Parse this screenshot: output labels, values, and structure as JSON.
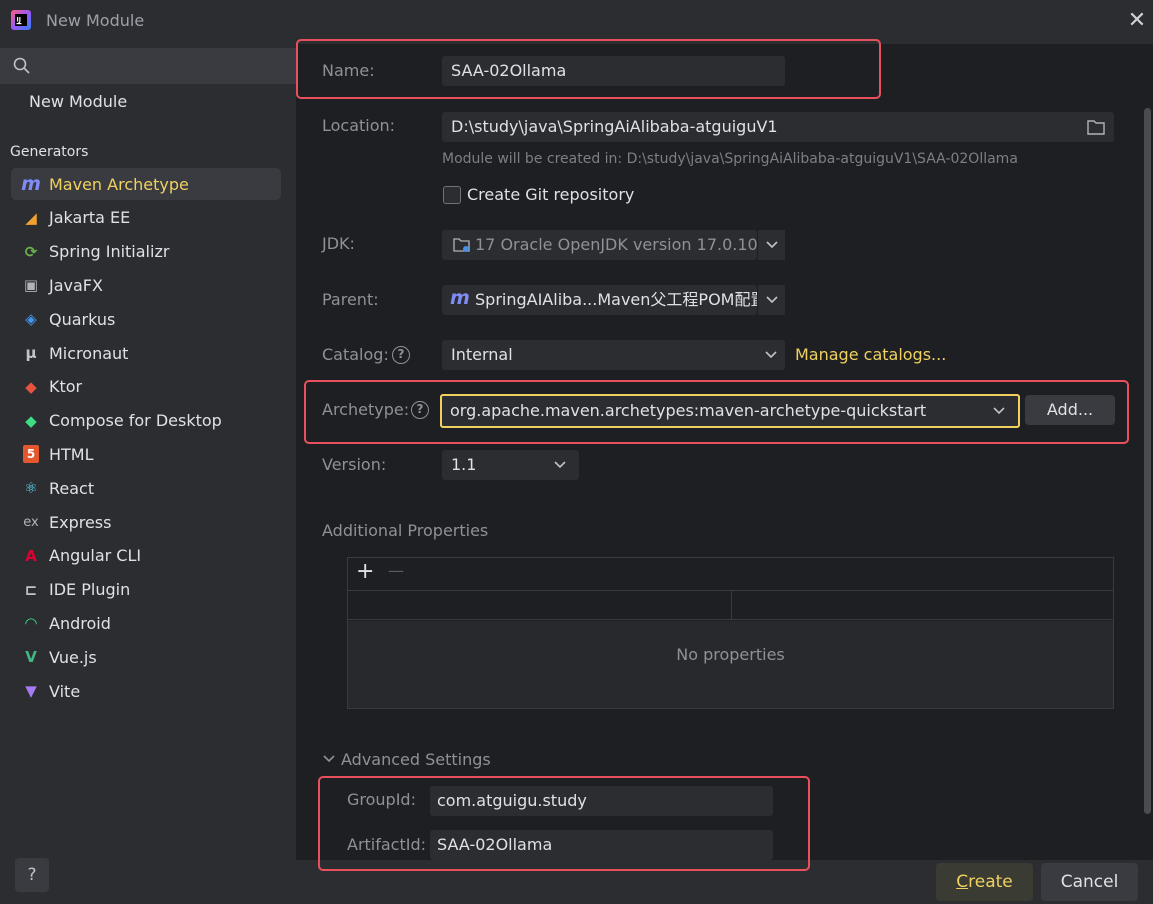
{
  "window": {
    "title": "New Module",
    "close_glyph": "✕"
  },
  "sidebar": {
    "new_module_label": "New Module",
    "generators_label": "Generators",
    "items": [
      {
        "label": "Maven Archetype",
        "icon": "maven-icon",
        "glyph": "m",
        "color": "#7f8cf5",
        "selected": true
      },
      {
        "label": "Jakarta EE",
        "icon": "jakarta-icon",
        "glyph": "◢",
        "color": "#f0a030"
      },
      {
        "label": "Spring Initializr",
        "icon": "spring-icon",
        "glyph": "⟳",
        "color": "#6ab04c"
      },
      {
        "label": "JavaFX",
        "icon": "javafx-icon",
        "glyph": "▣",
        "color": "#b0b3b8"
      },
      {
        "label": "Quarkus",
        "icon": "quarkus-icon",
        "glyph": "◈",
        "color": "#4695eb"
      },
      {
        "label": "Micronaut",
        "icon": "micronaut-icon",
        "glyph": "µ",
        "color": "#c0c2c7"
      },
      {
        "label": "Ktor",
        "icon": "ktor-icon",
        "glyph": "◆",
        "color": "#e4533f"
      },
      {
        "label": "Compose for Desktop",
        "icon": "compose-icon",
        "glyph": "◆",
        "color": "#3ddc84"
      },
      {
        "label": "HTML",
        "icon": "html-icon",
        "glyph": "5",
        "color": "#e4572e"
      },
      {
        "label": "React",
        "icon": "react-icon",
        "glyph": "⚛",
        "color": "#61dafb"
      },
      {
        "label": "Express",
        "icon": "express-icon",
        "glyph": "ex",
        "color": "#b0b3b8"
      },
      {
        "label": "Angular CLI",
        "icon": "angular-icon",
        "glyph": "A",
        "color": "#dd0031"
      },
      {
        "label": "IDE Plugin",
        "icon": "plugin-icon",
        "glyph": "⊏",
        "color": "#c0c2c7"
      },
      {
        "label": "Android",
        "icon": "android-icon",
        "glyph": "◠",
        "color": "#3ddc84"
      },
      {
        "label": "Vue.js",
        "icon": "vue-icon",
        "glyph": "V",
        "color": "#41b883"
      },
      {
        "label": "Vite",
        "icon": "vite-icon",
        "glyph": "▼",
        "color": "#a77bf3"
      }
    ],
    "help_glyph": "?"
  },
  "form": {
    "name_label": "Name:",
    "name_value": "SAA-02Ollama",
    "location_label": "Location:",
    "location_value": "D:\\study\\java\\SpringAiAlibaba-atguiguV1",
    "location_hint": "Module will be created in: D:\\study\\java\\SpringAiAlibaba-atguiguV1\\SAA-02Ollama",
    "git_label": "Create Git repository",
    "jdk_label": "JDK:",
    "jdk_value": "17 Oracle OpenJDK version 17.0.10",
    "parent_label": "Parent:",
    "parent_value": "SpringAIAliba...Maven父工程POM配置",
    "catalog_label": "Catalog:",
    "catalog_value": "Internal",
    "manage_catalogs": "Manage catalogs...",
    "archetype_label": "Archetype:",
    "archetype_value": "org.apache.maven.archetypes:maven-archetype-quickstart",
    "add_button": "Add...",
    "version_label": "Version:",
    "version_value": "1.1",
    "additional_props_label": "Additional Properties",
    "add_prop_glyph": "+",
    "remove_prop_glyph": "—",
    "no_properties": "No properties",
    "advanced_label": "Advanced Settings",
    "groupid_label": "GroupId:",
    "groupid_value": "com.atguigu.study",
    "artifactid_label": "ArtifactId:",
    "artifactid_value": "SAA-02Ollama"
  },
  "footer": {
    "create_first_letter": "C",
    "create_rest": "reate",
    "cancel_label": "Cancel"
  },
  "colors": {
    "accent": "#f0d160",
    "highlight_red": "#e8515c",
    "primary_button": "#3a3b33"
  }
}
